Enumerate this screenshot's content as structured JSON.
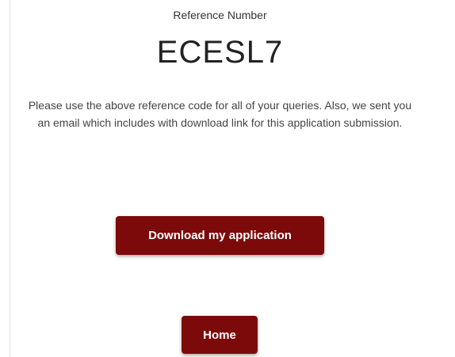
{
  "reference": {
    "label": "Reference Number",
    "code": "ECESL7"
  },
  "message": "Please use the above reference code for all of your queries. Also, we sent you an email which includes with download link for this application submission.",
  "actions": {
    "download_label": "Download my application",
    "home_label": "Home"
  },
  "colors": {
    "button_bg": "#7d0a0a",
    "button_text": "#ffffff"
  }
}
